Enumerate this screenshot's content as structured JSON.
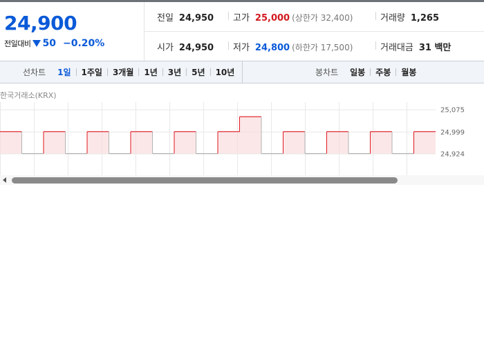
{
  "price": {
    "current": "24,900",
    "change_label": "전일대비",
    "change_amount": "50",
    "change_percent": "−0.20%"
  },
  "stats": {
    "prev_close": {
      "label": "전일",
      "value": "24,950"
    },
    "high": {
      "label": "고가",
      "value": "25,000",
      "limit": "(상한가 32,400)"
    },
    "volume": {
      "label": "거래량",
      "value": "1,265"
    },
    "open": {
      "label": "시가",
      "value": "24,950"
    },
    "low": {
      "label": "저가",
      "value": "24,800",
      "limit": "(하한가 17,500)"
    },
    "amount": {
      "label": "거래대금",
      "value": "31 백만"
    }
  },
  "period_bar": {
    "line_chart_label": "선차트",
    "line_periods": [
      "1일",
      "1주일",
      "3개월",
      "1년",
      "3년",
      "5년",
      "10년"
    ],
    "active_period": "1일",
    "candle_chart_label": "봉차트",
    "candle_periods": [
      "일봉",
      "주봉",
      "월봉"
    ]
  },
  "chart": {
    "source": "한국거래소(KRX)",
    "y_ticks": [
      "25,075",
      "24,999",
      "24,924"
    ],
    "colors": {
      "up": "#e0161e",
      "down": "#2f69d6",
      "flat": "#b3b3b3",
      "grid": "#e8e8e8"
    }
  },
  "chart_data": {
    "type": "line",
    "ylim": [
      24850,
      25100
    ],
    "y_ticks": [
      25075,
      24999,
      24924
    ],
    "series": [
      {
        "values": [
          24999,
          24924,
          24999,
          24924,
          24999,
          24924,
          24999,
          24924,
          24999,
          24924,
          24999,
          25050,
          24924,
          24999,
          24924,
          24999,
          24924,
          24999,
          24924,
          24999
        ]
      }
    ]
  }
}
